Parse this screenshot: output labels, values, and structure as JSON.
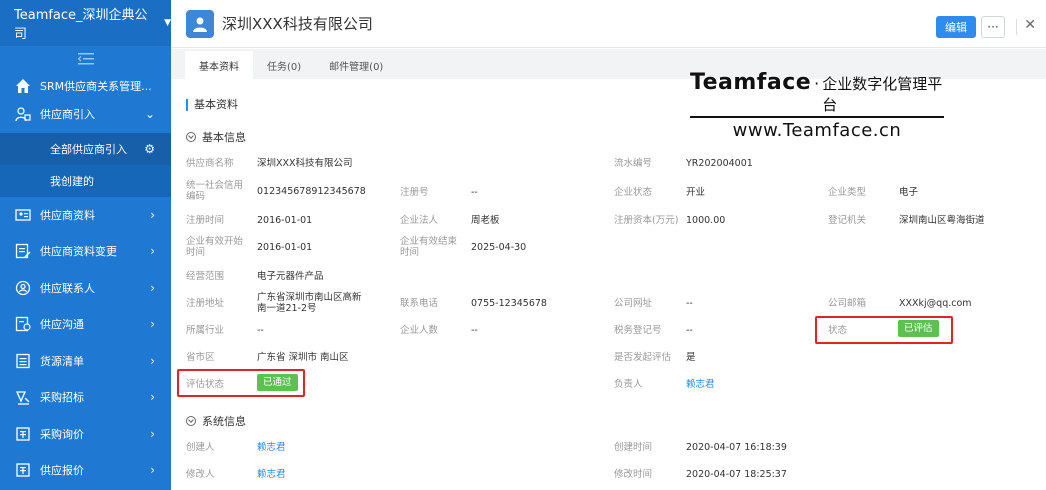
{
  "sidebar": {
    "company": "Teamface_深圳企典公司",
    "app_title": "SRM供应商关系管理...",
    "items": [
      {
        "label": "供应商引入",
        "icon": "supplier-intro-icon"
      },
      {
        "label": "供应商资料",
        "icon": "supplier-profile-icon"
      },
      {
        "label": "供应商资料变更",
        "icon": "profile-change-icon"
      },
      {
        "label": "供应联系人",
        "icon": "contact-icon"
      },
      {
        "label": "供应沟通",
        "icon": "communication-icon"
      },
      {
        "label": "货源清单",
        "icon": "source-list-icon"
      },
      {
        "label": "采购招标",
        "icon": "bidding-icon"
      },
      {
        "label": "采购询价",
        "icon": "inquiry-icon"
      },
      {
        "label": "供应报价",
        "icon": "quote-icon"
      }
    ],
    "sub_items": [
      {
        "label": "全部供应商引入"
      },
      {
        "label": "我创建的"
      }
    ]
  },
  "header": {
    "title": "深圳XXX科技有限公司",
    "edit_label": "编辑",
    "more_label": "···",
    "close_label": "✕"
  },
  "tabs": [
    {
      "label": "基本资料"
    },
    {
      "label": "任务(0)"
    },
    {
      "label": "邮件管理(0)"
    }
  ],
  "watermark": {
    "brand": "Teamface",
    "dot": "·",
    "slogan": "企业数字化管理平台",
    "url": "www.Teamface.cn"
  },
  "section_title": "基本资料",
  "groups": {
    "basic": "基本信息",
    "system": "系统信息"
  },
  "fields": {
    "supplier_name": {
      "label": "供应商名称",
      "value": "深圳XXX科技有限公司"
    },
    "serial_no": {
      "label": "流水编号",
      "value": "YR202004001"
    },
    "credit_code": {
      "label": "统一社会信用编码",
      "value": "012345678912345678"
    },
    "reg_no": {
      "label": "注册号",
      "value": "--"
    },
    "company_status": {
      "label": "企业状态",
      "value": "开业"
    },
    "company_type": {
      "label": "企业类型",
      "value": "电子"
    },
    "reg_date": {
      "label": "注册时间",
      "value": "2016-01-01"
    },
    "legal_person": {
      "label": "企业法人",
      "value": "周老板"
    },
    "reg_capital": {
      "label": "注册资本(万元)",
      "value": "1000.00"
    },
    "reg_authority": {
      "label": "登记机关",
      "value": "深圳南山区粤海街道"
    },
    "valid_start": {
      "label": "企业有效开始时间",
      "value": "2016-01-01"
    },
    "valid_end": {
      "label": "企业有效结束时间",
      "value": "2025-04-30"
    },
    "business_scope": {
      "label": "经营范围",
      "value": "电子元器件产品"
    },
    "reg_address": {
      "label": "注册地址",
      "value": "广东省深圳市南山区高新南一道21-2号"
    },
    "phone": {
      "label": "联系电话",
      "value": "0755-12345678"
    },
    "website": {
      "label": "公司网址",
      "value": "--"
    },
    "email": {
      "label": "公司邮箱",
      "value": "XXXkj@qq.com"
    },
    "industry": {
      "label": "所属行业",
      "value": "--"
    },
    "headcount": {
      "label": "企业人数",
      "value": "--"
    },
    "tax_no": {
      "label": "税务登记号",
      "value": "--"
    },
    "status": {
      "label": "状态",
      "value": "已评估"
    },
    "region": {
      "label": "省市区",
      "value": "广东省 深圳市 南山区"
    },
    "initiated_eval": {
      "label": "是否发起评估",
      "value": "是"
    },
    "eval_status": {
      "label": "评估状态",
      "value": "已通过"
    },
    "owner": {
      "label": "负责人",
      "value": "赖志君"
    },
    "creator": {
      "label": "创建人",
      "value": "赖志君"
    },
    "created_at": {
      "label": "创建时间",
      "value": "2020-04-07 16:18:39"
    },
    "modifier": {
      "label": "修改人",
      "value": "赖志君"
    },
    "modified_at": {
      "label": "修改时间",
      "value": "2020-04-07 18:25:37"
    }
  },
  "colors": {
    "sidebar_bg": "#1f78d1",
    "accent": "#2d8cf0",
    "badge_green": "#5fbf55",
    "highlight_red": "#e02424"
  }
}
